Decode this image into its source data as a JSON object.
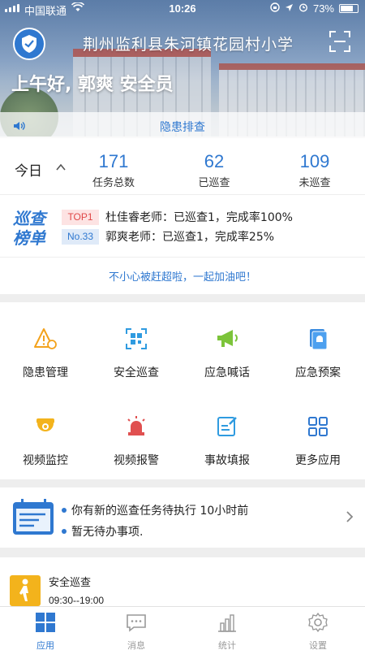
{
  "status_bar": {
    "carrier": "中国联通",
    "time": "10:26",
    "battery": "73%"
  },
  "header": {
    "title": "荆州监利县朱河镇花园村小学",
    "greeting": "上午好, 郭爽 安全员",
    "notice": "隐患排查"
  },
  "stats": {
    "period": "今日",
    "items": [
      {
        "value": "171",
        "label": "任务总数"
      },
      {
        "value": "62",
        "label": "已巡查"
      },
      {
        "value": "109",
        "label": "未巡查"
      }
    ]
  },
  "ranking": {
    "logo_top": "巡查",
    "logo_bottom": "榜单",
    "rows": [
      {
        "tag": "TOP1",
        "text": "杜佳睿老师：已巡查1，完成率100%"
      },
      {
        "tag": "No.33",
        "text": "郭爽老师：已巡查1，完成率25%"
      }
    ],
    "cheer": "不小心被赶超啦，一起加油吧！"
  },
  "apps": [
    {
      "label": "隐患管理",
      "icon": "hazard-warning-icon"
    },
    {
      "label": "安全巡查",
      "icon": "qr-scan-icon"
    },
    {
      "label": "应急喊话",
      "icon": "megaphone-icon"
    },
    {
      "label": "应急预案",
      "icon": "emergency-plan-icon"
    },
    {
      "label": "视频监控",
      "icon": "camera-icon"
    },
    {
      "label": "视频报警",
      "icon": "alarm-light-icon"
    },
    {
      "label": "事故填报",
      "icon": "edit-form-icon"
    },
    {
      "label": "更多应用",
      "icon": "grid-icon"
    }
  ],
  "tasks": {
    "lines": [
      "你有新的巡查任务待执行 10小时前",
      "暂无待办事项."
    ]
  },
  "patrol": {
    "title": "安全巡查",
    "time": "09:30--19:00"
  },
  "tabbar": [
    {
      "label": "应用",
      "active": true
    },
    {
      "label": "消息",
      "active": false
    },
    {
      "label": "统计",
      "active": false
    },
    {
      "label": "设置",
      "active": false
    }
  ],
  "colors": {
    "accent": "#2f78d0",
    "warning": "#f3b31c",
    "danger": "#e04848"
  }
}
